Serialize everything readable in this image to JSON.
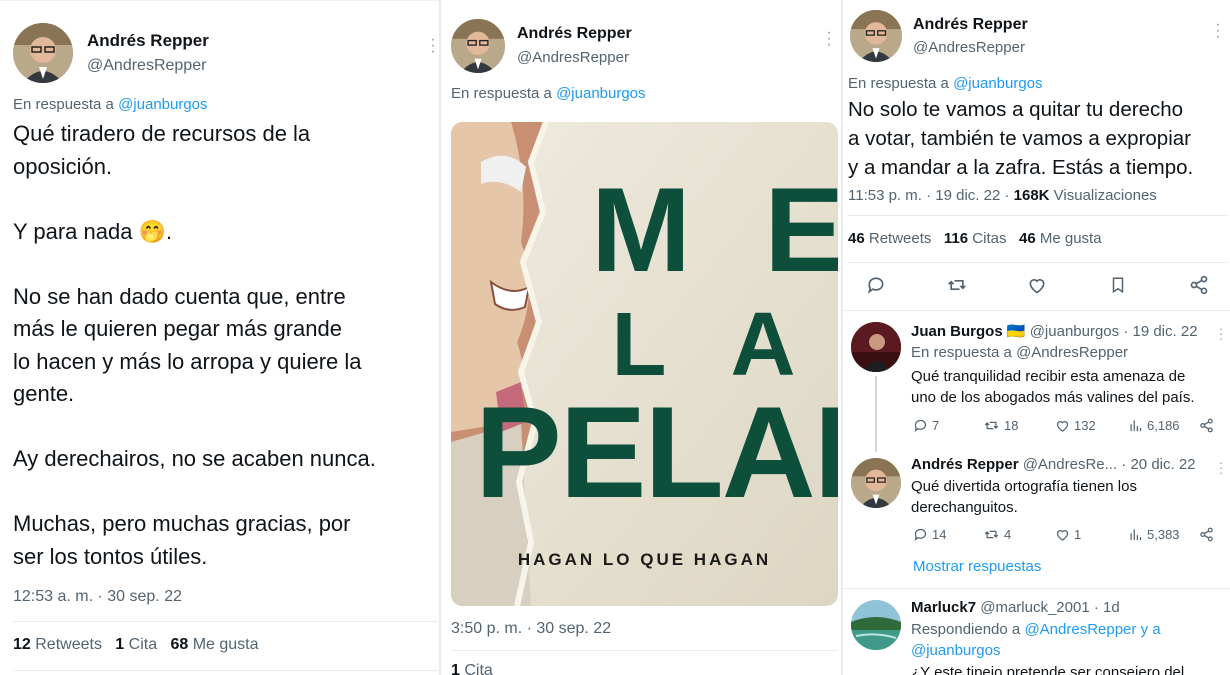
{
  "panel1": {
    "author_name": "Andrés Repper",
    "author_handle": "@AndresRepper",
    "reply_prefix": "En respuesta a",
    "reply_to": "@juanburgos",
    "text_lines": [
      "Qué tiradero de recursos de la",
      "oposición.",
      "",
      "Y para nada 🤭.",
      "",
      "No se han dado cuenta que, entre",
      "más le quieren pegar más grande",
      "lo hacen y más lo arropa y quiere la",
      "gente.",
      "",
      "Ay derechairos, no se acaben nunca.",
      "",
      "Muchas, pero muchas gracias, por",
      "ser los tontos útiles."
    ],
    "timestamp": "12:53 a. m. · 30 sep. 22",
    "retweets_count": "12",
    "retweets_label": "Retweets",
    "quotes_count": "1",
    "quotes_label": "Cita",
    "likes_count": "68",
    "likes_label": "Me gusta"
  },
  "panel2": {
    "author_name": "Andrés Repper",
    "author_handle": "@AndresRepper",
    "reply_prefix": "En respuesta a",
    "reply_to": "@juanburgos",
    "cover_words": [
      "M E",
      "L A",
      "PELAN"
    ],
    "cover_subtitle": "HAGAN LO QUE HAGAN",
    "timestamp": "3:50 p. m. · 30 sep. 22",
    "quotes_count": "1",
    "quotes_label": "Cita"
  },
  "panel3": {
    "author_name": "Andrés Repper",
    "author_handle": "@AndresRepper",
    "reply_prefix": "En respuesta a",
    "reply_to": "@juanburgos",
    "text_lines": [
      "No solo te vamos a quitar tu derecho",
      "a votar, también te vamos a expropiar",
      "y a mandar a la zafra. Estás a tiempo."
    ],
    "timestamp": "11:53 p. m. · 19 dic. 22 · ",
    "views_count": "168K",
    "views_label": "Visualizaciones",
    "retweets_count": "46",
    "retweets_label": "Retweets",
    "quotes_count": "116",
    "quotes_label": "Citas",
    "likes_count": "46",
    "likes_label": "Me gusta",
    "actions": [
      "reply-icon",
      "retweet-icon",
      "like-icon",
      "bookmark-icon",
      "share-icon"
    ],
    "replies": [
      {
        "name": "Juan Burgos 🇺🇦",
        "handle": "@juanburgos · 19 dic. 22",
        "reply_prefix": "En respuesta a",
        "reply_to": "@AndresRepper",
        "text_lines": [
          "Qué tranquilidad recibir esta amenaza de",
          "uno de los abogados más valines del país."
        ],
        "replies": "7",
        "retweets": "18",
        "likes": "132",
        "views": "6,186"
      },
      {
        "name": "Andrés Repper",
        "handle": "@AndresRe... · 20 dic. 22",
        "text_lines": [
          "Qué divertida ortografía tienen los",
          "derechanguitos."
        ],
        "replies": "14",
        "retweets": "4",
        "likes": "1",
        "views": "5,383",
        "show_replies": "Mostrar respuestas"
      },
      {
        "name": "Marluck7",
        "handle": "@marluck_2001 · 1d",
        "reply_prefix": "Respondiendo a",
        "reply_to_1": "@AndresRepper",
        "reply_and": "y a",
        "reply_to_2": "@juanburgos",
        "text_partial": "¿Y este tipejo pretende ser consejero del"
      }
    ]
  }
}
